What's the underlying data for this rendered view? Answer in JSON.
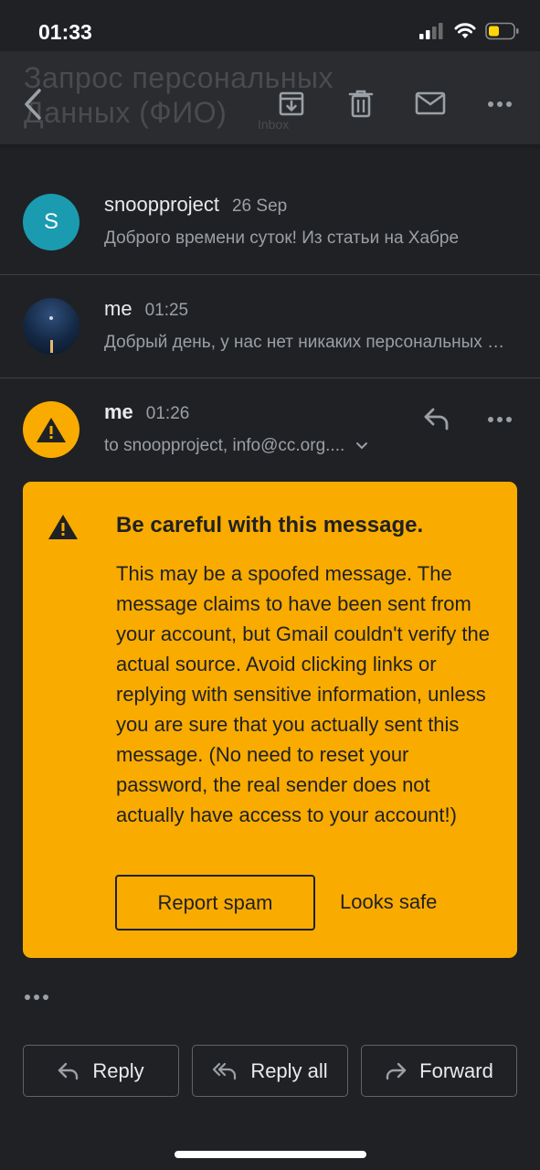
{
  "status_bar": {
    "time": "01:33"
  },
  "toolbar": {
    "ghost_title_line1": "Запрос персональных",
    "ghost_title_line2": "Данных (ФИО)",
    "ghost_tag": "Inbox"
  },
  "thread": [
    {
      "sender": "snoopproject",
      "time": "26 Sep",
      "snippet": "Доброго времени суток! Из статьи на Хабре",
      "avatar_letter": "S",
      "avatar_color": "#1a9bb0"
    },
    {
      "sender": "me",
      "time": "01:25",
      "snippet": "Добрый день, у нас нет никаких персональных данных"
    }
  ],
  "open_message": {
    "sender": "me",
    "time": "01:26",
    "recipients": "to snoopproject, info@cc.org...."
  },
  "warning": {
    "title": "Be careful with this message.",
    "body": "This may be a spoofed message. The message claims to have been sent from your account, but Gmail couldn't verify the actual source. Avoid clicking links or replying with sensitive information, unless you are sure that you actually sent this message. (No need to reset your password, the real sender does not actually have access to your account!)",
    "report_spam": "Report spam",
    "looks_safe": "Looks safe",
    "color": "#f9ab00"
  },
  "actions": {
    "reply": "Reply",
    "reply_all": "Reply all",
    "forward": "Forward"
  },
  "icons": [
    "back-icon",
    "archive-icon",
    "delete-icon",
    "mail-icon",
    "more-icon",
    "reply-icon",
    "warning-icon",
    "chevron-down-icon",
    "reply-all-icon",
    "forward-icon",
    "battery-icon",
    "wifi-icon",
    "signal-icon"
  ]
}
